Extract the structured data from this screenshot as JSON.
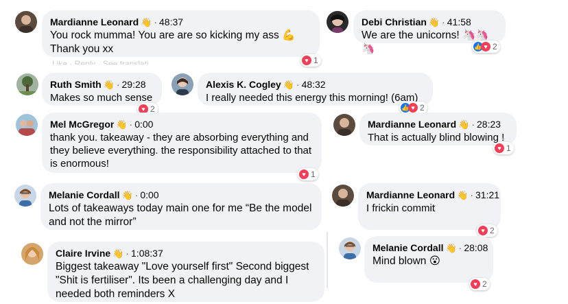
{
  "comments": [
    {
      "name": "Mardianne Leonard",
      "wave": "👋",
      "time": "48:37",
      "text": "You rock mumma! You are are so kicking my ass 💪 Thank you xx",
      "reactions": "1"
    },
    {
      "name": "Debi Christian",
      "wave": "👋",
      "time": "41:58",
      "text": "We are the unicorns! 🦄🦄🦄",
      "reactions": "2"
    },
    {
      "name": "Ruth Smith",
      "wave": "👋",
      "time": "29:28",
      "text": "Makes so much sense",
      "reactions": "2"
    },
    {
      "name": "Alexis K. Cogley",
      "wave": "👋",
      "time": "48:32",
      "text": "I really needed this energy this morning! (6am)",
      "reactions": "2"
    },
    {
      "name": "Mel McGregor",
      "wave": "👋",
      "time": "0:00",
      "text": "thank you. takeaway - they are absorbing everything and they believe everything. the responsibility attached to that is enormous!",
      "reactions": "1"
    },
    {
      "name": "Mardianne Leonard",
      "wave": "👋",
      "time": "28:23",
      "text": "That is actually blind blowing !",
      "reactions": "1"
    },
    {
      "name": "Melanie Cordall",
      "wave": "👋",
      "time": "0:00",
      "text": "Lots of takeaways today main one for me “Be the model and not the mirror”",
      "reactions": ""
    },
    {
      "name": "Mardianne Leonard",
      "wave": "👋",
      "time": "31:21",
      "text": "I frickin commit",
      "reactions": "2"
    },
    {
      "name": "Claire Irvine",
      "wave": "👋",
      "time": "1:08:37",
      "text": "Biggest takeaway \"Love yourself first\" Second biggest \"Shit is fertiliser\". Its been a challenging day and I needed both reminders X",
      "reactions": ""
    },
    {
      "name": "Melanie Cordall",
      "wave": "👋",
      "time": "28:08",
      "text": "Mind blown 😮",
      "reactions": "2"
    }
  ],
  "separator": "·",
  "ghost_actions": "Like · Reply · See translation"
}
